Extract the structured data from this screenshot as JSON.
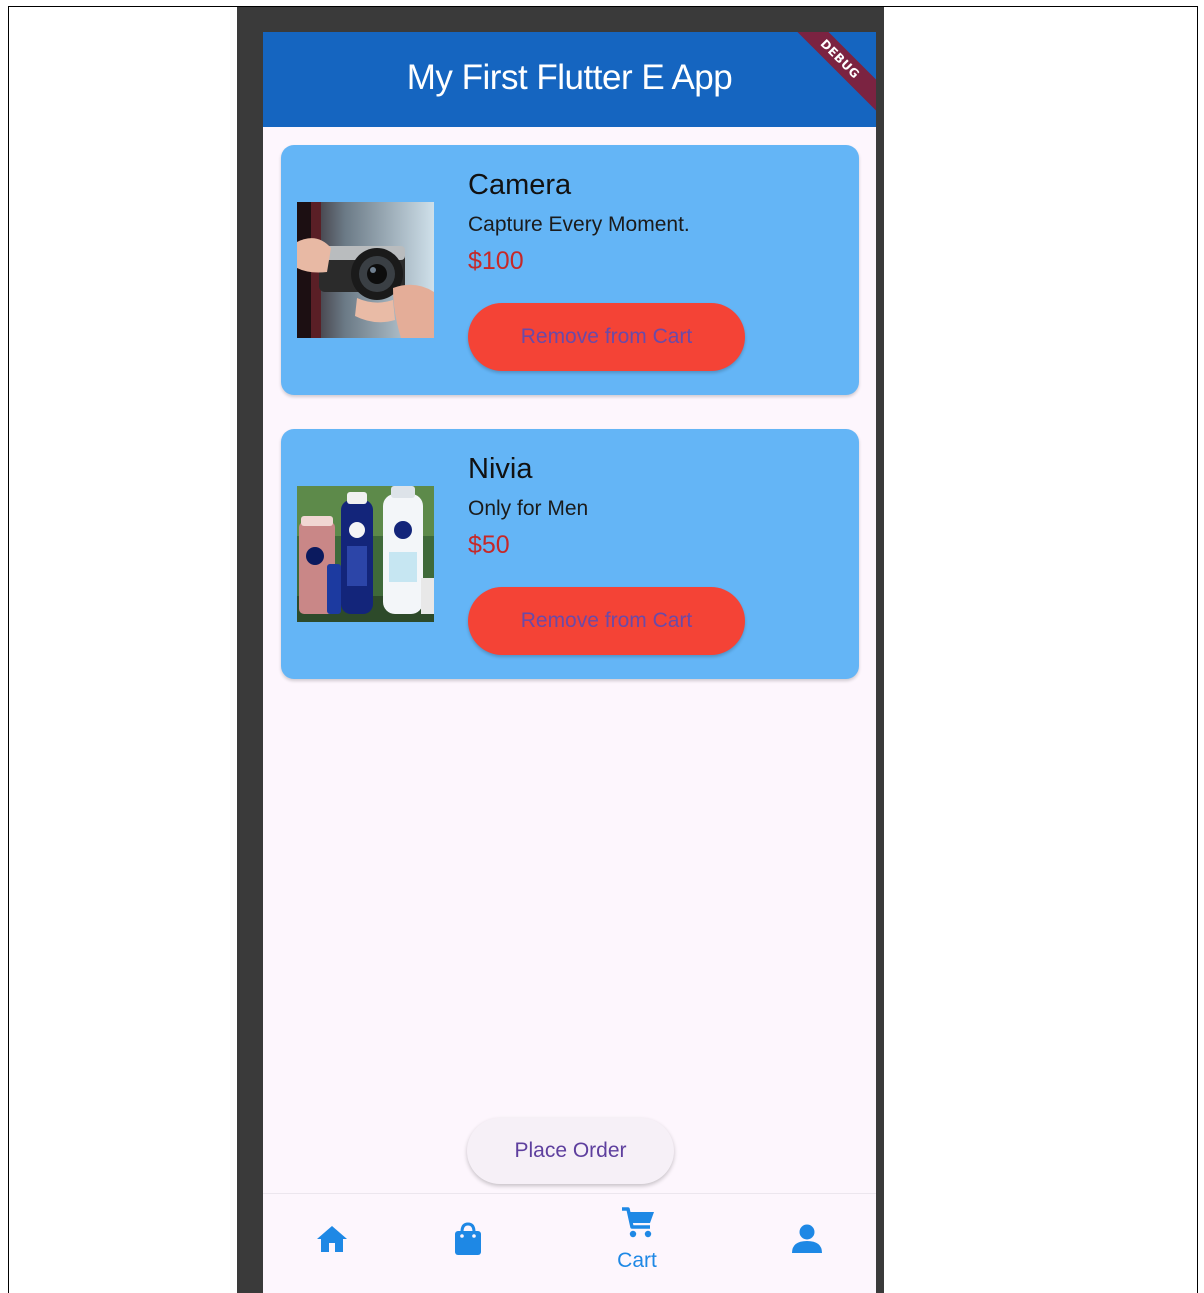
{
  "app": {
    "title": "My First Flutter E App",
    "debug_banner": "DEBUG",
    "colors": {
      "appbar": "#1565c0",
      "card": "#64b5f6",
      "remove_button": "#f44336",
      "price": "#c62828",
      "nav_active": "#1e88e5",
      "screen_bg": "#fdf6fd"
    }
  },
  "cart": {
    "items": [
      {
        "name": "Camera",
        "description": "Capture Every Moment.",
        "price": "$100",
        "button_label": "Remove from Cart",
        "image": "camera-photo"
      },
      {
        "name": "Nivia",
        "description": "Only for Men",
        "price": "$50",
        "button_label": "Remove from Cart",
        "image": "nivea-products-photo"
      }
    ],
    "place_order_label": "Place Order"
  },
  "bottom_nav": {
    "items": [
      {
        "icon": "home-icon",
        "label": ""
      },
      {
        "icon": "shopping-bag-icon",
        "label": ""
      },
      {
        "icon": "shopping-cart-icon",
        "label": "Cart",
        "active": true
      },
      {
        "icon": "person-icon",
        "label": ""
      }
    ]
  }
}
